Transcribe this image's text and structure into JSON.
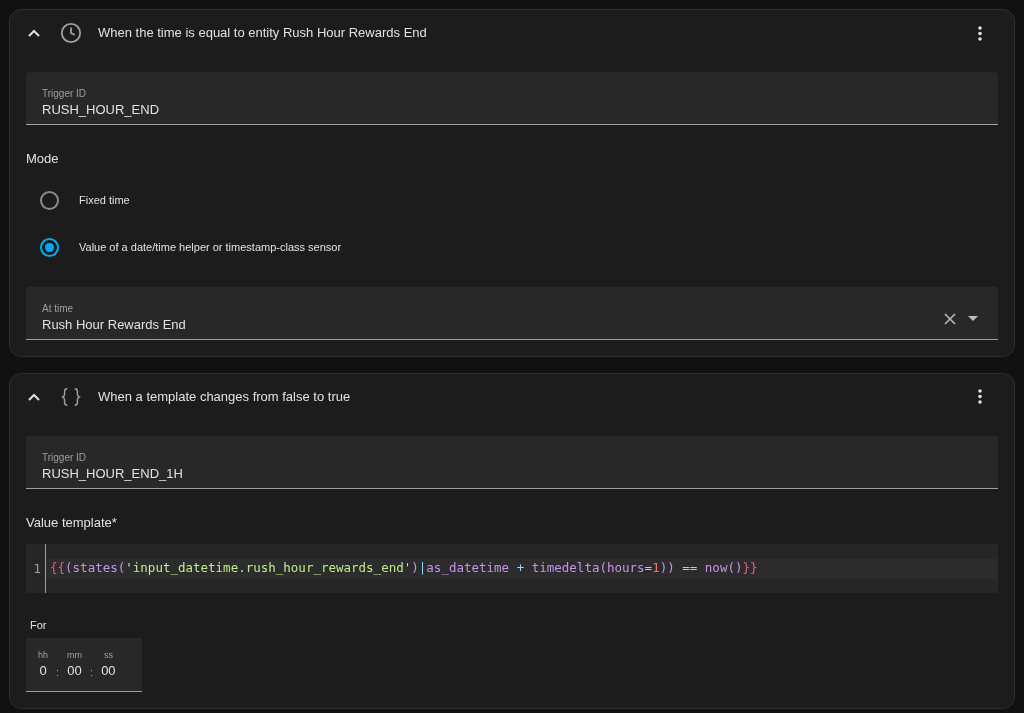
{
  "triggers": [
    {
      "kind": "clock",
      "title": "When the time is equal to entity Rush Hour Rewards End",
      "expanded": true,
      "trigger_id": {
        "label": "Trigger ID",
        "value": "RUSH_HOUR_END"
      },
      "fields": [
        {
          "kind": "radio_group",
          "label": "Mode",
          "options": [
            {
              "label": "Fixed time",
              "selected": false
            },
            {
              "label": "Value of a date/time helper or timestamp-class sensor",
              "selected": true
            }
          ]
        },
        {
          "kind": "entity_picker",
          "label": "At time",
          "value": "Rush Hour Rewards End"
        }
      ]
    },
    {
      "kind": "braces",
      "title": "When a template changes from false to true",
      "expanded": true,
      "trigger_id": {
        "label": "Trigger ID",
        "value": "RUSH_HOUR_END_1H"
      },
      "fields": [
        {
          "kind": "code_editor",
          "label": "Value template*",
          "line_number": "1",
          "tokens": [
            {
              "kind": "bracket",
              "text": "{{"
            },
            {
              "kind": "func",
              "text": "(states("
            },
            {
              "kind": "string",
              "text": "'input_datetime.rush_hour_rewards_end'"
            },
            {
              "kind": "func",
              "text": ")"
            },
            {
              "kind": "operator",
              "text": "|"
            },
            {
              "kind": "func",
              "text": "as_datetime"
            },
            {
              "kind": "operator",
              "text": " + "
            },
            {
              "kind": "func",
              "text": "timedelta(hours"
            },
            {
              "kind": "operator",
              "text": "="
            },
            {
              "kind": "number",
              "text": "1"
            },
            {
              "kind": "func",
              "text": "))"
            },
            {
              "kind": "operator",
              "text": " == "
            },
            {
              "kind": "func",
              "text": "now()"
            },
            {
              "kind": "bracket",
              "text": "}}"
            }
          ]
        },
        {
          "kind": "duration",
          "label": "For",
          "parts": [
            {
              "label": "hh",
              "value": "0"
            },
            {
              "label": "mm",
              "value": "00"
            },
            {
              "label": "ss",
              "value": "00"
            }
          ],
          "separators": [
            ":",
            ":"
          ]
        }
      ]
    }
  ]
}
